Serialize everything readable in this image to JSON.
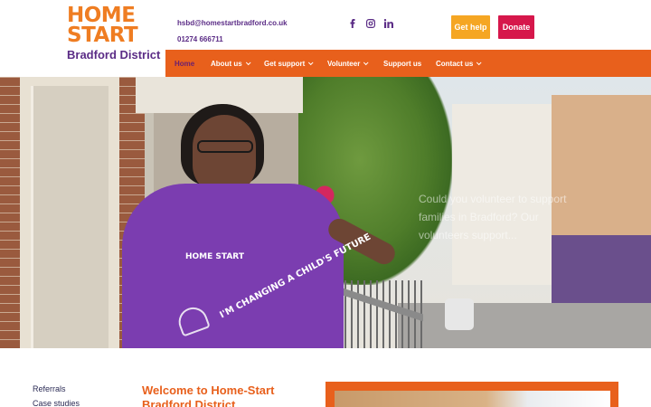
{
  "header": {
    "logo": {
      "line1": "HOME",
      "line2": "START",
      "line3": "Bradford District"
    },
    "email": "hsbd@homestartbradford.co.uk",
    "phone": "01274 666711",
    "social_icons": [
      "facebook-icon",
      "instagram-icon",
      "linkedin-icon"
    ],
    "buttons": {
      "get_help": "Get help",
      "donate": "Donate"
    }
  },
  "nav": {
    "items": [
      {
        "label": "Home",
        "active": true,
        "dropdown": false
      },
      {
        "label": "About us",
        "active": false,
        "dropdown": true
      },
      {
        "label": "Get support",
        "active": false,
        "dropdown": true
      },
      {
        "label": "Volunteer",
        "active": false,
        "dropdown": true
      },
      {
        "label": "Support us",
        "active": false,
        "dropdown": false
      },
      {
        "label": "Contact us",
        "active": false,
        "dropdown": true
      }
    ]
  },
  "hero": {
    "shirt_logo": "HOME START",
    "shirt_slogan": "I'M CHANGING A CHILD'S FUTURE",
    "overlay_text": "Could you volunteer to support families in Bradford? Our volunteers support..."
  },
  "sidebar": {
    "links": [
      "Referrals",
      "Case studies"
    ]
  },
  "main": {
    "welcome_title": "Welcome to Home-Start Bradford District"
  },
  "colors": {
    "brand_orange": "#e8601c",
    "brand_purple": "#5b2c86",
    "get_help_bg": "#f5a623",
    "donate_bg": "#d6174b"
  }
}
